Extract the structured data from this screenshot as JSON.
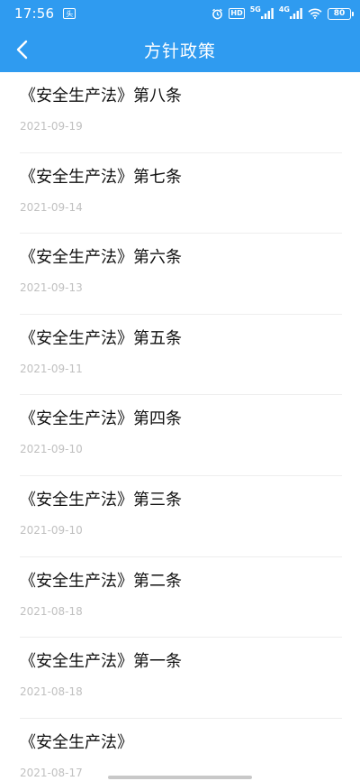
{
  "status_bar": {
    "time": "17:56",
    "notify_glyph": "头",
    "net1": "5G",
    "net2": "4G",
    "battery": "80",
    "hd": "HD"
  },
  "nav": {
    "title": "方针政策",
    "back_icon": "chevron-left-icon"
  },
  "colors": {
    "header_bg": "#2f9bf0",
    "title_text": "#111111",
    "date_text": "#c0c0c0",
    "divider": "#eeeeee"
  },
  "articles": [
    {
      "title": "《安全生产法》第八条",
      "date": "2021-09-19"
    },
    {
      "title": "《安全生产法》第七条",
      "date": "2021-09-14"
    },
    {
      "title": "《安全生产法》第六条",
      "date": "2021-09-13"
    },
    {
      "title": "《安全生产法》第五条",
      "date": "2021-09-11"
    },
    {
      "title": "《安全生产法》第四条",
      "date": "2021-09-10"
    },
    {
      "title": "《安全生产法》第三条",
      "date": "2021-09-10"
    },
    {
      "title": "《安全生产法》第二条",
      "date": "2021-08-18"
    },
    {
      "title": "《安全生产法》第一条",
      "date": "2021-08-18"
    },
    {
      "title": "《安全生产法》",
      "date": "2021-08-17"
    }
  ]
}
